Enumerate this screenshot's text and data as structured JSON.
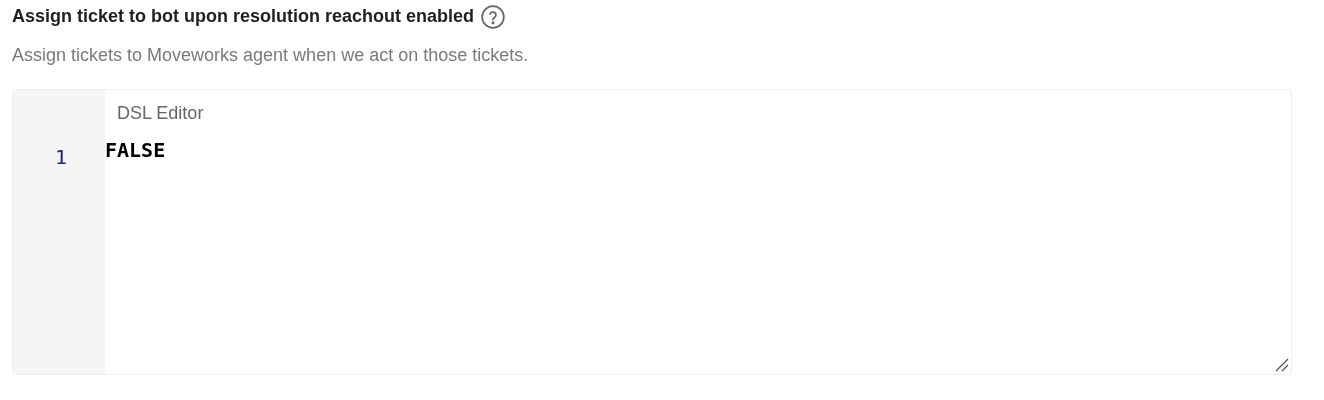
{
  "setting": {
    "title": "Assign ticket to bot upon resolution reachout enabled",
    "description": "Assign tickets to Moveworks agent when we act on those tickets."
  },
  "editor": {
    "label": "DSL Editor",
    "lines": [
      {
        "number": "1",
        "code": "FALSE"
      }
    ]
  }
}
